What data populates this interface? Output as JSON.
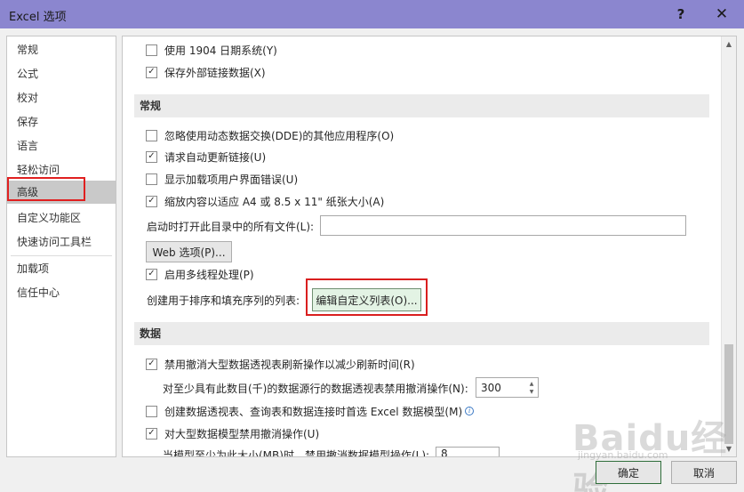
{
  "window": {
    "title": "Excel 选项",
    "help_glyph": "?",
    "close_glyph": "✕"
  },
  "sidebar": {
    "items": [
      {
        "label": "常规"
      },
      {
        "label": "公式"
      },
      {
        "label": "校对"
      },
      {
        "label": "保存"
      },
      {
        "label": "语言"
      },
      {
        "label": "轻松访问"
      },
      {
        "label": "高级",
        "selected": true
      },
      {
        "label": "自定义功能区"
      },
      {
        "label": "快速访问工具栏"
      },
      {
        "label": "加载项"
      },
      {
        "label": "信任中心"
      }
    ]
  },
  "content": {
    "top_options": [
      {
        "label": "使用 1904 日期系统(Y)",
        "checked": false
      },
      {
        "label": "保存外部链接数据(X)",
        "checked": true
      }
    ],
    "general_section": {
      "title": "常规",
      "options": [
        {
          "label": "忽略使用动态数据交换(DDE)的其他应用程序(O)",
          "checked": false
        },
        {
          "label": "请求自动更新链接(U)",
          "checked": true
        },
        {
          "label": "显示加载项用户界面错误(U)",
          "checked": false
        },
        {
          "label": "缩放内容以适应 A4 或 8.5 x 11\" 纸张大小(A)",
          "checked": true
        }
      ],
      "startup_folder_label": "启动时打开此目录中的所有文件(L):",
      "startup_folder_value": "",
      "web_options_button": "Web 选项(P)...",
      "multithread_label": "启用多线程处理(P)",
      "multithread_checked": true,
      "custom_list_label": "创建用于排序和填充序列的列表:",
      "custom_list_button": "编辑自定义列表(O)..."
    },
    "data_section": {
      "title": "数据",
      "disable_undo_pivot_label": "禁用撤消大型数据透视表刷新操作以减少刷新时间(R)",
      "disable_undo_pivot_checked": true,
      "pivot_rows_label": "对至少具有此数目(千)的数据源行的数据透视表禁用撤消操作(N):",
      "pivot_rows_value": "300",
      "prefer_data_model_label": "创建数据透视表、查询表和数据连接时首选 Excel 数据模型(M)",
      "prefer_data_model_checked": false,
      "disable_undo_model_label": "对大型数据模型禁用撤消操作(U)",
      "disable_undo_model_checked": true,
      "model_size_label": "当模型至少为此大小(MB)时，禁用撤消数据模型操作(L):",
      "model_size_value": "8"
    }
  },
  "footer": {
    "ok_label": "确定",
    "cancel_label": "取消"
  },
  "watermark": {
    "text": "Baidu经验",
    "sub": "jingyan.baidu.com"
  },
  "colors": {
    "title_bar": "#8b86cf",
    "highlight_red": "#e02020",
    "selected_item": "#c9c9c9"
  }
}
